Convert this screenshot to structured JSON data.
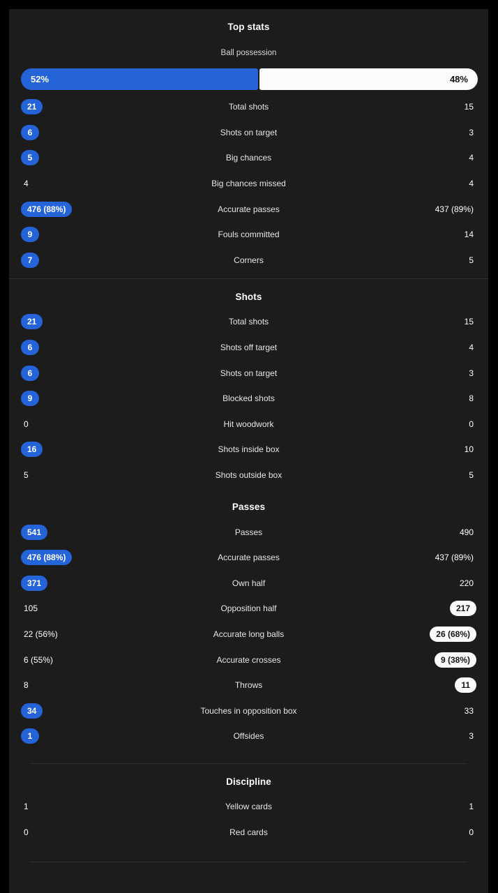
{
  "theme": {
    "background": "#000000",
    "panel": "#1c1c1c",
    "accent_home": "#2563d9",
    "accent_away": "#fbfbfb",
    "text": "#ffffff",
    "divider": "#2e2e2e"
  },
  "sections": [
    {
      "title": "Top stats",
      "possession": {
        "label": "Ball possession",
        "home_value": "52%",
        "away_value": "48%",
        "home_pct": 52,
        "away_pct": 48
      },
      "rows": [
        {
          "label": "Total shots",
          "home": "21",
          "away": "15",
          "home_style": "pill-blue",
          "away_style": "plain"
        },
        {
          "label": "Shots on target",
          "home": "6",
          "away": "3",
          "home_style": "pill-blue",
          "away_style": "plain"
        },
        {
          "label": "Big chances",
          "home": "5",
          "away": "4",
          "home_style": "pill-blue",
          "away_style": "plain"
        },
        {
          "label": "Big chances missed",
          "home": "4",
          "away": "4",
          "home_style": "plain",
          "away_style": "plain"
        },
        {
          "label": "Accurate passes",
          "home": "476 (88%)",
          "away": "437 (89%)",
          "home_style": "pill-blue",
          "away_style": "plain"
        },
        {
          "label": "Fouls committed",
          "home": "9",
          "away": "14",
          "home_style": "pill-blue",
          "away_style": "plain"
        },
        {
          "label": "Corners",
          "home": "7",
          "away": "5",
          "home_style": "pill-blue",
          "away_style": "plain"
        }
      ],
      "divider_after": "full"
    },
    {
      "title": "Shots",
      "rows": [
        {
          "label": "Total shots",
          "home": "21",
          "away": "15",
          "home_style": "pill-blue",
          "away_style": "plain"
        },
        {
          "label": "Shots off target",
          "home": "6",
          "away": "4",
          "home_style": "pill-blue",
          "away_style": "plain"
        },
        {
          "label": "Shots on target",
          "home": "6",
          "away": "3",
          "home_style": "pill-blue",
          "away_style": "plain"
        },
        {
          "label": "Blocked shots",
          "home": "9",
          "away": "8",
          "home_style": "pill-blue",
          "away_style": "plain"
        },
        {
          "label": "Hit woodwork",
          "home": "0",
          "away": "0",
          "home_style": "plain",
          "away_style": "plain"
        },
        {
          "label": "Shots inside box",
          "home": "16",
          "away": "10",
          "home_style": "pill-blue",
          "away_style": "plain"
        },
        {
          "label": "Shots outside box",
          "home": "5",
          "away": "5",
          "home_style": "plain",
          "away_style": "plain"
        }
      ],
      "divider_after": "none"
    },
    {
      "title": "Passes",
      "rows": [
        {
          "label": "Passes",
          "home": "541",
          "away": "490",
          "home_style": "pill-blue",
          "away_style": "plain"
        },
        {
          "label": "Accurate passes",
          "home": "476 (88%)",
          "away": "437 (89%)",
          "home_style": "pill-blue",
          "away_style": "plain"
        },
        {
          "label": "Own half",
          "home": "371",
          "away": "220",
          "home_style": "pill-blue",
          "away_style": "plain"
        },
        {
          "label": "Opposition half",
          "home": "105",
          "away": "217",
          "home_style": "plain",
          "away_style": "pill-white"
        },
        {
          "label": "Accurate long balls",
          "home": "22 (56%)",
          "away": "26 (68%)",
          "home_style": "plain",
          "away_style": "pill-white"
        },
        {
          "label": "Accurate crosses",
          "home": "6 (55%)",
          "away": "9 (38%)",
          "home_style": "plain",
          "away_style": "pill-white"
        },
        {
          "label": "Throws",
          "home": "8",
          "away": "11",
          "home_style": "plain",
          "away_style": "pill-white"
        },
        {
          "label": "Touches in opposition box",
          "home": "34",
          "away": "33",
          "home_style": "pill-blue",
          "away_style": "plain"
        },
        {
          "label": "Offsides",
          "home": "1",
          "away": "3",
          "home_style": "pill-blue",
          "away_style": "plain"
        }
      ],
      "divider_after": "inset"
    },
    {
      "title": "Discipline",
      "rows": [
        {
          "label": "Yellow cards",
          "home": "1",
          "away": "1",
          "home_style": "plain",
          "away_style": "plain"
        },
        {
          "label": "Red cards",
          "home": "0",
          "away": "0",
          "home_style": "plain",
          "away_style": "plain"
        }
      ],
      "divider_after": "bottom"
    }
  ]
}
